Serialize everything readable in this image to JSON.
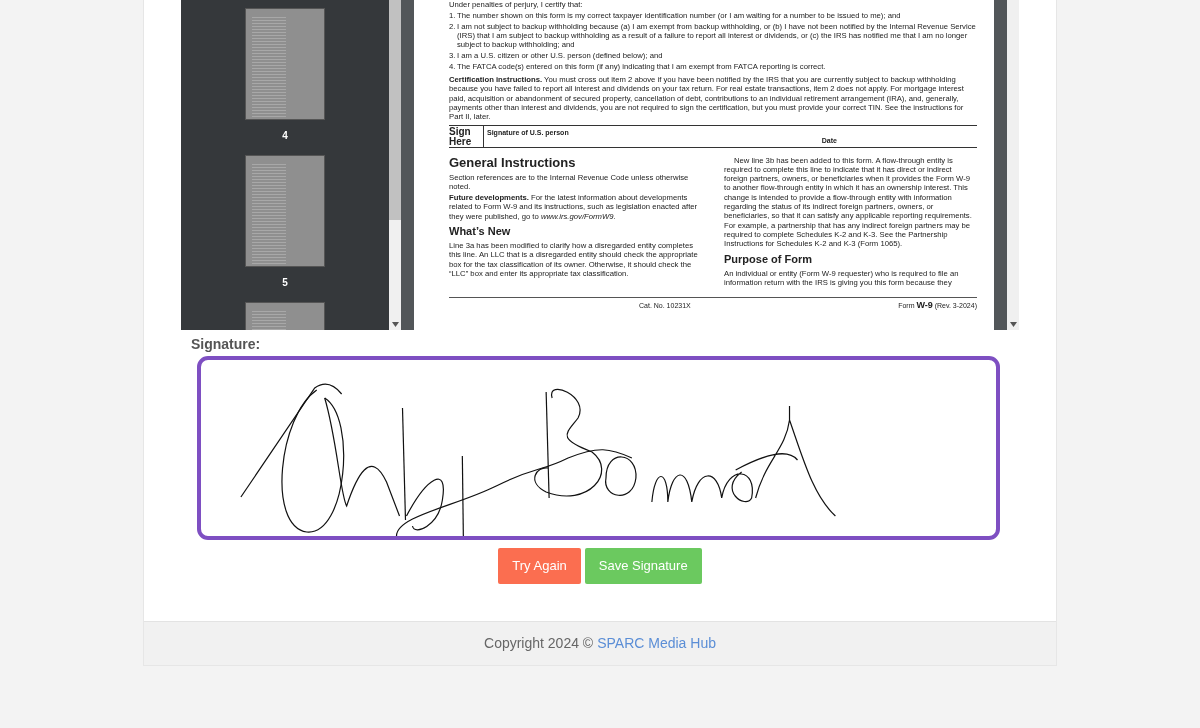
{
  "pdf_viewer": {
    "thumbnails": [
      {
        "label": "4"
      },
      {
        "label": "5"
      }
    ],
    "document": {
      "intro": "Under penalties of perjury, I certify that:",
      "items": [
        {
          "num": "1.",
          "text": "The number shown on this form is my correct taxpayer identification number (or I am waiting for a number to be issued to me); and"
        },
        {
          "num": "2.",
          "text": "I am not subject to backup withholding because (a) I am exempt from backup withholding, or (b) I have not been notified by the Internal Revenue Service (IRS) that I am subject to backup withholding as a result of a failure to report all interest or dividends, or (c) the IRS has notified me that I am no longer subject to backup withholding; and"
        },
        {
          "num": "3.",
          "text": "I am a U.S. citizen or other U.S. person (defined below); and"
        },
        {
          "num": "4.",
          "text": "The FATCA code(s) entered on this form (if any) indicating that I am exempt from FATCA reporting is correct."
        }
      ],
      "certification": "**Certification instructions.** You must cross out item 2 above if you have been notified by the IRS that you are currently subject to backup withholding because you have failed to report all interest and dividends on your tax return. For real estate transactions, item 2 does not apply. For mortgage interest paid, acquisition or abandonment of secured property, cancellation of debt, contributions to an individual retirement arrangement (IRA), and, generally, payments other than interest and dividends, you are not required to sign the certification, but you must provide your correct TIN. See the instructions for Part II, later.",
      "sign": {
        "label": "Sign Here",
        "signature_label": "Signature of U.S. person",
        "date_label": "Date"
      },
      "left_column": [
        {
          "kind": "heading",
          "text": "General Instructions"
        },
        {
          "kind": "paragraph",
          "text": "Section references are to the Internal Revenue Code unless otherwise noted."
        },
        {
          "kind": "paragraph",
          "text": "**Future developments.** For the latest information about developments related to Form W-9 and its instructions, such as legislation enacted after they were published, go to *www.irs.gov/FormW9*."
        },
        {
          "kind": "subheading",
          "text": "What’s New"
        },
        {
          "kind": "paragraph",
          "text": "Line 3a has been modified to clarify how a disregarded entity completes this line. An LLC that is a disregarded entity should check the appropriate box for the tax classification of its owner. Otherwise, it should check the “LLC” box and enter its appropriate tax classification."
        }
      ],
      "right_column": [
        {
          "kind": "indented",
          "text": "New line 3b has been added to this form. A flow-through entity is required to complete this line to indicate that it has direct or indirect foreign partners, owners, or beneficiaries when it provides the Form W-9 to another flow-through entity in which it has an ownership interest. This change is intended to provide a flow-through entity with information regarding the status of its indirect foreign partners, owners, or beneficiaries, so that it can satisfy any applicable reporting requirements. For example, a partnership that has any indirect foreign partners may be required to complete Schedules K-2 and K-3. See the Partnership Instructions for Schedules K-2 and K-3 (Form 1065)."
        },
        {
          "kind": "subheading",
          "text": "Purpose of Form"
        },
        {
          "kind": "paragraph",
          "text": "An individual or entity (Form W-9 requester) who is required to file an information return with the IRS is giving you this form because they"
        }
      ],
      "catalog_number": "Cat. No. 10231X",
      "form_id": "Form **W-9** (Rev. 3-2024)"
    }
  },
  "signature": {
    "label": "Signature:"
  },
  "buttons": [
    {
      "kind": "retry",
      "label": "Try Again"
    },
    {
      "kind": "save",
      "label": "Save Signature"
    }
  ],
  "footer": {
    "text": "Copyright 2024 © ",
    "link": "SPARC Media Hub"
  }
}
